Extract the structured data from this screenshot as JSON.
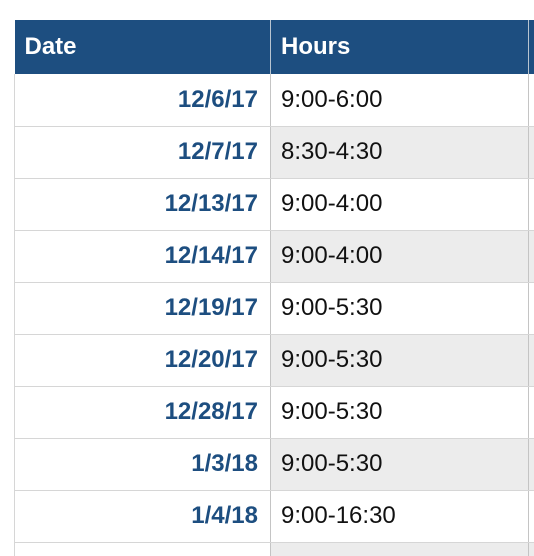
{
  "table": {
    "headers": {
      "date": "Date",
      "hours": "Hours"
    },
    "rows": [
      {
        "date": "12/6/17",
        "hours": "9:00-6:00"
      },
      {
        "date": "12/7/17",
        "hours": "8:30-4:30"
      },
      {
        "date": "12/13/17",
        "hours": "9:00-4:00"
      },
      {
        "date": "12/14/17",
        "hours": "9:00-4:00"
      },
      {
        "date": "12/19/17",
        "hours": "9:00-5:30"
      },
      {
        "date": "12/20/17",
        "hours": "9:00-5:30"
      },
      {
        "date": "12/28/17",
        "hours": "9:00-5:30"
      },
      {
        "date": "1/3/18",
        "hours": "9:00-5:30"
      },
      {
        "date": "1/4/18",
        "hours": "9:00-16:30"
      }
    ]
  },
  "colors": {
    "header_bg": "#1d4e80",
    "header_text": "#ffffff",
    "date_text": "#1d4e80",
    "alt_row_bg": "#ececec"
  }
}
